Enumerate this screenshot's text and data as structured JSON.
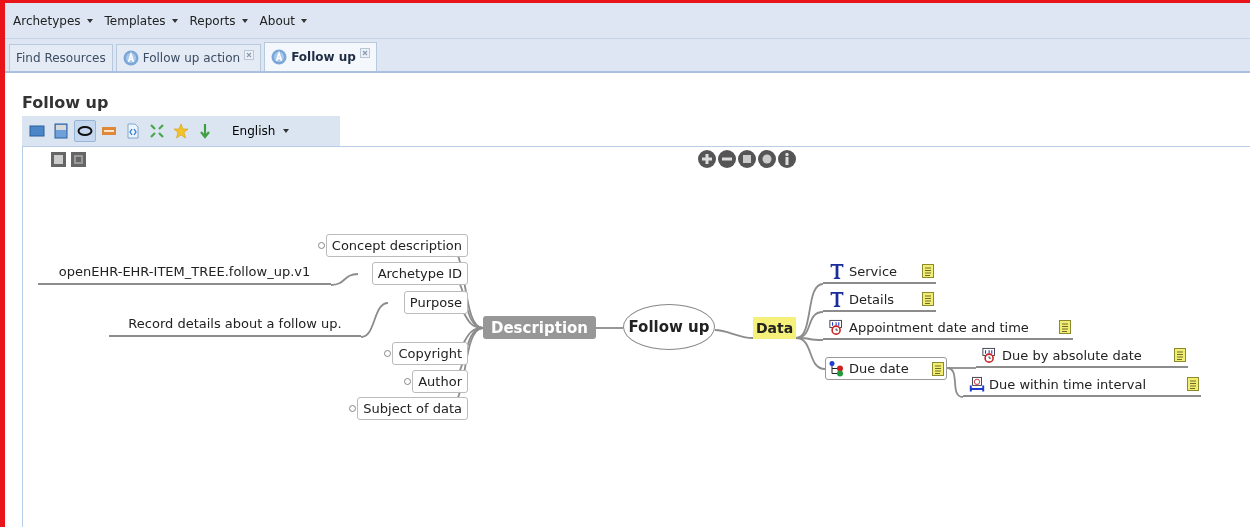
{
  "menu": [
    {
      "label": "Archetypes"
    },
    {
      "label": "Templates"
    },
    {
      "label": "Reports"
    },
    {
      "label": "About"
    }
  ],
  "tabs": [
    {
      "label": "Find Resources",
      "selected": false,
      "closable": false
    },
    {
      "label": "Follow up action",
      "selected": false,
      "closable": true
    },
    {
      "label": "Follow up",
      "selected": true,
      "closable": true
    }
  ],
  "heading": "Follow up",
  "toolbar": {
    "tools": [
      {
        "kind": "panel",
        "selected": false
      },
      {
        "kind": "document",
        "selected": false
      },
      {
        "kind": "ellipse",
        "selected": true
      },
      {
        "kind": "badge",
        "selected": false
      },
      {
        "kind": "code",
        "selected": false
      },
      {
        "kind": "expand",
        "selected": false
      },
      {
        "kind": "star",
        "selected": false
      },
      {
        "kind": "download",
        "selected": false
      }
    ],
    "language": "English"
  },
  "mindmap": {
    "root": "Follow up",
    "description": {
      "label": "Description",
      "items": [
        {
          "label": "Concept description",
          "collapsed": true
        },
        {
          "label": "Archetype ID",
          "collapsed": false,
          "value": "openEHR-EHR-ITEM_TREE.follow_up.v1"
        },
        {
          "label": "Purpose",
          "collapsed": false,
          "value": "Record details about a follow up."
        },
        {
          "label": "Copyright",
          "collapsed": true
        },
        {
          "label": "Author",
          "collapsed": true
        },
        {
          "label": "Subject of data",
          "collapsed": true
        }
      ]
    },
    "data": {
      "label": "Data",
      "items": [
        {
          "label": "Service",
          "kind": "text"
        },
        {
          "label": "Details",
          "kind": "text"
        },
        {
          "label": "Appointment date and time",
          "kind": "datetime"
        },
        {
          "label": "Due date",
          "kind": "cluster",
          "children": [
            {
              "label": "Due by absolute date",
              "kind": "datetime"
            },
            {
              "label": "Due within time interval",
              "kind": "duration"
            }
          ]
        }
      ]
    }
  }
}
